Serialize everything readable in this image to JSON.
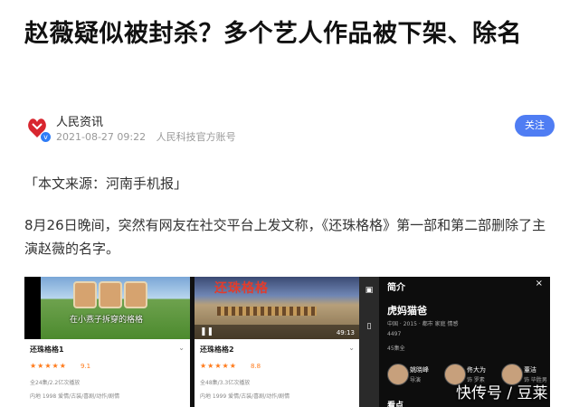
{
  "article": {
    "headline": "赵薇疑似被封杀？多个艺人作品被下架、除名",
    "source_line": "「本文来源：河南手机报」",
    "paragraph": "8月26日晚间，突然有网友在社交平台上发文称，《还珠格格》第一部和第二部删除了主演赵薇的名字。"
  },
  "author": {
    "name": "人民资讯",
    "datetime": "2021-08-27 09:22",
    "account": "人民科技官方账号",
    "follow_label": "关注"
  },
  "screenshot": {
    "video1_caption": "在小燕子拆穿的格格",
    "video2_art": "还珠格格",
    "video2_time": "49:13",
    "panels": [
      {
        "title": "还珠格格1",
        "stars": "★★★★★",
        "score": "9.1",
        "plays": "全24集/2.2亿次播放",
        "tags": "内地 1998 爱情/古装/喜剧/动作/剧情"
      },
      {
        "title": "还珠格格2",
        "stars": "★★★★★",
        "score": "8.8",
        "plays": "全48集/3.3亿次播放",
        "tags": "内地 1999 爱情/古装/喜剧/动作/剧情"
      }
    ],
    "intro": {
      "heading": "简介",
      "close": "×",
      "title": "虎妈猫爸",
      "meta": "中国 · 2015 · 都市 家庭 情感",
      "count": "4497",
      "episodes": "45集全",
      "people": [
        {
          "name": "姚晓峰",
          "role": "导演"
        },
        {
          "name": "佟大为",
          "role": "饰 罗素"
        },
        {
          "name": "董洁",
          "role": "饰 毕胜男"
        }
      ],
      "section2": "看点"
    }
  },
  "watermark": "快传号 / 豆莱",
  "colors": {
    "accent": "#4f7df3",
    "star": "#ff7a1a"
  }
}
